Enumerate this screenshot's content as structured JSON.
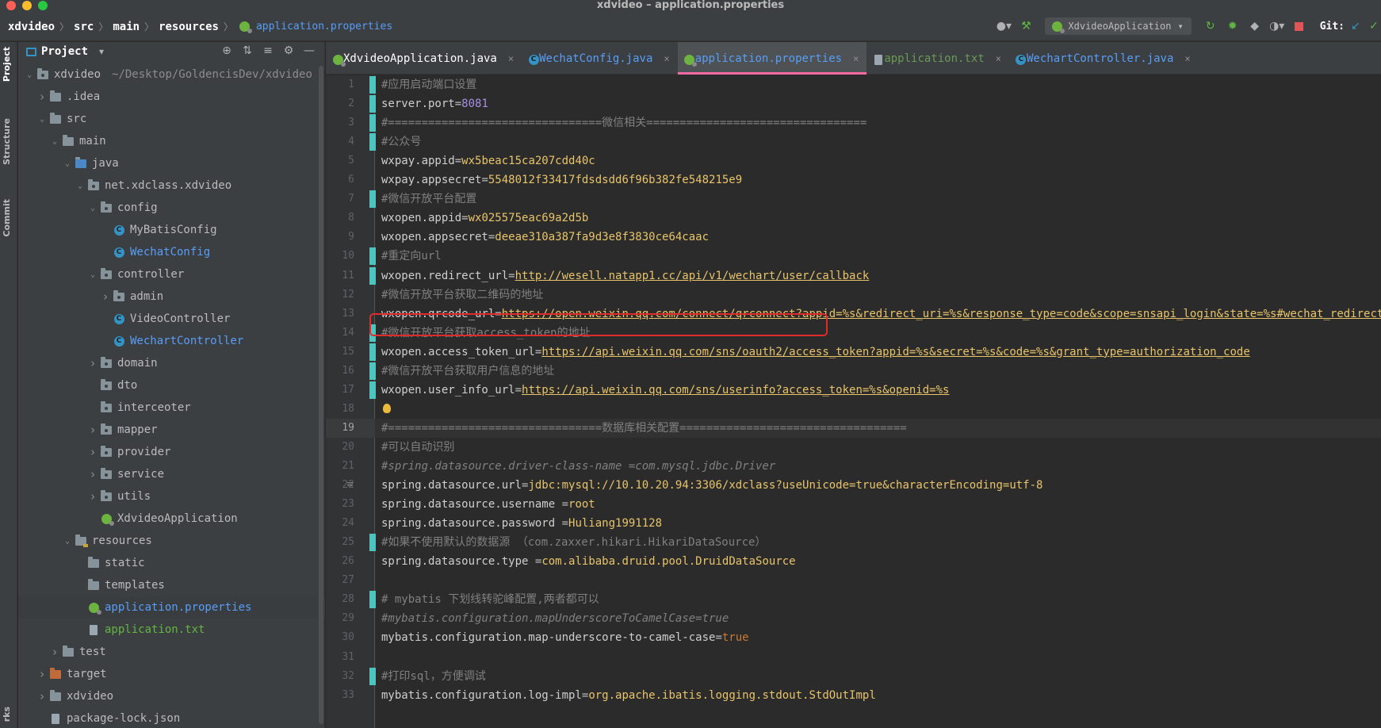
{
  "window": {
    "title": "xdvideo – application.properties",
    "traffic_colors": [
      "#ff5f57",
      "#febc2e",
      "#28c840"
    ]
  },
  "breadcrumb": [
    "xdvideo",
    "src",
    "main",
    "resources"
  ],
  "breadcrumb_file": "application.properties",
  "toolbar": {
    "run_config": "XdvideoApplication",
    "git_label": "Git:"
  },
  "toolstrip": {
    "project": "Project",
    "structure": "Structure",
    "commit": "Commit",
    "bookmarks": "rks"
  },
  "project_panel": {
    "title": "Project",
    "tree": [
      {
        "label": "xdvideo",
        "extra": "~/Desktop/GoldencisDev/xdvideo",
        "depth": 0,
        "chev": "open",
        "icon": "module",
        "color": "strong"
      },
      {
        "label": ".idea",
        "depth": 1,
        "chev": "closed",
        "icon": "folder",
        "color": "default"
      },
      {
        "label": "src",
        "depth": 1,
        "chev": "open",
        "icon": "folder",
        "color": "default"
      },
      {
        "label": "main",
        "depth": 2,
        "chev": "open",
        "icon": "folder",
        "color": "default"
      },
      {
        "label": "java",
        "depth": 3,
        "chev": "open",
        "icon": "folder-src",
        "color": "default"
      },
      {
        "label": "net.xdclass.xdvideo",
        "depth": 4,
        "chev": "open",
        "icon": "package",
        "color": "default"
      },
      {
        "label": "config",
        "depth": 5,
        "chev": "open",
        "icon": "package",
        "color": "default"
      },
      {
        "label": "MyBatisConfig",
        "depth": 6,
        "chev": "",
        "icon": "class",
        "color": "default"
      },
      {
        "label": "WechatConfig",
        "depth": 6,
        "chev": "",
        "icon": "class",
        "color": "blue"
      },
      {
        "label": "controller",
        "depth": 5,
        "chev": "open",
        "icon": "package",
        "color": "default"
      },
      {
        "label": "admin",
        "depth": 6,
        "chev": "closed",
        "icon": "package",
        "color": "default"
      },
      {
        "label": "VideoController",
        "depth": 6,
        "chev": "",
        "icon": "class",
        "color": "default"
      },
      {
        "label": "WechartController",
        "depth": 6,
        "chev": "",
        "icon": "class",
        "color": "blue"
      },
      {
        "label": "domain",
        "depth": 5,
        "chev": "closed",
        "icon": "package",
        "color": "default"
      },
      {
        "label": "dto",
        "depth": 5,
        "chev": "",
        "icon": "package",
        "color": "default"
      },
      {
        "label": "interceoter",
        "depth": 5,
        "chev": "",
        "icon": "package",
        "color": "default"
      },
      {
        "label": "mapper",
        "depth": 5,
        "chev": "closed",
        "icon": "package",
        "color": "default"
      },
      {
        "label": "provider",
        "depth": 5,
        "chev": "closed",
        "icon": "package",
        "color": "default"
      },
      {
        "label": "service",
        "depth": 5,
        "chev": "closed",
        "icon": "package",
        "color": "default"
      },
      {
        "label": "utils",
        "depth": 5,
        "chev": "closed",
        "icon": "package",
        "color": "default"
      },
      {
        "label": "XdvideoApplication",
        "depth": 5,
        "chev": "",
        "icon": "spring-class",
        "color": "default"
      },
      {
        "label": "resources",
        "depth": 3,
        "chev": "open",
        "icon": "folder-res",
        "color": "default"
      },
      {
        "label": "static",
        "depth": 4,
        "chev": "",
        "icon": "folder",
        "color": "default"
      },
      {
        "label": "templates",
        "depth": 4,
        "chev": "",
        "icon": "folder",
        "color": "default"
      },
      {
        "label": "application.properties",
        "depth": 4,
        "chev": "",
        "icon": "spring-file",
        "color": "blue",
        "selected": true
      },
      {
        "label": "application.txt",
        "depth": 4,
        "chev": "",
        "icon": "file",
        "color": "green"
      },
      {
        "label": "test",
        "depth": 2,
        "chev": "closed",
        "icon": "folder",
        "color": "default"
      },
      {
        "label": "target",
        "depth": 1,
        "chev": "closed",
        "icon": "folder-orange",
        "color": "default"
      },
      {
        "label": "xdvideo",
        "depth": 1,
        "chev": "closed",
        "icon": "folder",
        "color": "default"
      },
      {
        "label": "package-lock.json",
        "depth": 1,
        "chev": "",
        "icon": "file-json",
        "color": "default"
      }
    ]
  },
  "tabs": [
    {
      "label": "XdvideoApplication.java",
      "icon": "spring-class",
      "color": "#ffffff",
      "active": false
    },
    {
      "label": "WechatConfig.java",
      "icon": "class",
      "color": "#589df6",
      "active": false
    },
    {
      "label": "application.properties",
      "icon": "spring-file",
      "color": "#589df6",
      "active": true
    },
    {
      "label": "application.txt",
      "icon": "file",
      "color": "#6a9955",
      "active": false
    },
    {
      "label": "WechartController.java",
      "icon": "class",
      "color": "#589df6",
      "active": false
    }
  ],
  "editor": {
    "current_line": 19,
    "lines": [
      {
        "n": "1",
        "parts": [
          [
            "cmt",
            "#应用启动端口设置"
          ]
        ],
        "changed": true
      },
      {
        "n": "2",
        "parts": [
          [
            "key",
            "server.port"
          ],
          [
            "eq",
            "="
          ],
          [
            "num",
            "8081"
          ]
        ],
        "changed": true
      },
      {
        "n": "3",
        "parts": [
          [
            "cmt",
            "#================================微信相关================================="
          ]
        ],
        "changed": true
      },
      {
        "n": "4",
        "parts": [
          [
            "cmt",
            "#公众号"
          ]
        ],
        "changed": true
      },
      {
        "n": "5",
        "parts": [
          [
            "key",
            "wxpay.appid"
          ],
          [
            "eq",
            "="
          ],
          [
            "val",
            "wx5beac15ca207cdd40c"
          ]
        ],
        "changed": false
      },
      {
        "n": "6",
        "parts": [
          [
            "key",
            "wxpay.appsecret"
          ],
          [
            "eq",
            "="
          ],
          [
            "val",
            "5548012f33417fdsdsdd6f96b382fe548215e9"
          ]
        ],
        "changed": false
      },
      {
        "n": "7",
        "parts": [
          [
            "cmt",
            "#微信开放平台配置"
          ]
        ],
        "changed": true
      },
      {
        "n": "8",
        "parts": [
          [
            "key",
            "wxopen.appid"
          ],
          [
            "eq",
            "="
          ],
          [
            "val",
            "wx025575eac69a2d5b"
          ]
        ],
        "changed": false
      },
      {
        "n": "9",
        "parts": [
          [
            "key",
            "wxopen.appsecret"
          ],
          [
            "eq",
            "="
          ],
          [
            "val",
            "deeae310a387fa9d3e8f3830ce64caac"
          ]
        ],
        "changed": false
      },
      {
        "n": "10",
        "parts": [
          [
            "cmt",
            "#重定向url"
          ]
        ],
        "changed": true
      },
      {
        "n": "11",
        "parts": [
          [
            "key",
            "wxopen.redirect_url"
          ],
          [
            "eq",
            "="
          ],
          [
            "url",
            "http://wesell.natapp1.cc/api/v1/wechart/user/callback"
          ]
        ],
        "changed": true
      },
      {
        "n": "12",
        "parts": [
          [
            "cmt",
            "#微信开放平台获取二维码的地址"
          ]
        ],
        "changed": false
      },
      {
        "n": "13",
        "parts": [
          [
            "key",
            "wxopen.qrcode_url"
          ],
          [
            "eq",
            "="
          ],
          [
            "url",
            "https://open.weixin.qq.com/connect/qrconnect?appid=%s&redirect_uri=%s&response_type=code&scope=snsapi_login&state=%s#wechat_redirect"
          ]
        ],
        "changed": false
      },
      {
        "n": "14",
        "parts": [
          [
            "cmt",
            "#微信开放平台获取access_token的地址"
          ]
        ],
        "changed": true
      },
      {
        "n": "15",
        "parts": [
          [
            "key",
            "wxopen.access_token_url"
          ],
          [
            "eq",
            "="
          ],
          [
            "url",
            "https://api.weixin.qq.com/sns/oauth2/access_token?appid=%s&secret=%s&code=%s&grant_type=authorization_code"
          ]
        ],
        "changed": true
      },
      {
        "n": "16",
        "parts": [
          [
            "cmt",
            "#微信开放平台获取用户信息的地址"
          ]
        ],
        "changed": true
      },
      {
        "n": "17",
        "parts": [
          [
            "key",
            "wxopen.user_info_url"
          ],
          [
            "eq",
            "="
          ],
          [
            "url",
            "https://api.weixin.qq.com/sns/userinfo?access_token=%s&openid=%s"
          ]
        ],
        "changed": true
      },
      {
        "n": "18",
        "parts": [],
        "changed": false
      },
      {
        "n": "19",
        "parts": [
          [
            "cmt",
            "#================================数据库相关配置=================================="
          ]
        ],
        "changed": false
      },
      {
        "n": "20",
        "parts": [
          [
            "cmt",
            "#可以自动识别"
          ]
        ],
        "changed": false
      },
      {
        "n": "21",
        "parts": [
          [
            "cmti",
            "#spring.datasource.driver-class-name =com.mysql.jdbc.Driver"
          ]
        ],
        "changed": false
      },
      {
        "n": "22",
        "parts": [
          [
            "key",
            "spring.datasource.url"
          ],
          [
            "eq",
            "="
          ],
          [
            "val",
            "jdbc:mysql://10.10.20.94:3306/xdclass?useUnicode=true&characterEncoding=utf-8"
          ]
        ],
        "changed": false
      },
      {
        "n": "23",
        "parts": [
          [
            "key",
            "spring.datasource.username "
          ],
          [
            "eq",
            "="
          ],
          [
            "val",
            "root"
          ]
        ],
        "changed": false
      },
      {
        "n": "24",
        "parts": [
          [
            "key",
            "spring.datasource.password "
          ],
          [
            "eq",
            "="
          ],
          [
            "val",
            "Huliang1991128"
          ]
        ],
        "changed": false
      },
      {
        "n": "25",
        "parts": [
          [
            "cmt",
            "#如果不使用默认的数据源 （com.zaxxer.hikari.HikariDataSource）"
          ]
        ],
        "changed": true
      },
      {
        "n": "26",
        "parts": [
          [
            "key",
            "spring.datasource.type "
          ],
          [
            "eq",
            "="
          ],
          [
            "val",
            "com.alibaba.druid.pool.DruidDataSource"
          ]
        ],
        "changed": false
      },
      {
        "n": "27",
        "parts": [],
        "changed": false
      },
      {
        "n": "28",
        "parts": [
          [
            "cmt",
            "# mybatis 下划线转驼峰配置,两者都可以"
          ]
        ],
        "changed": true
      },
      {
        "n": "29",
        "parts": [
          [
            "cmti",
            "#mybatis.configuration.mapUnderscoreToCamelCase=true"
          ]
        ],
        "changed": false
      },
      {
        "n": "30",
        "parts": [
          [
            "key",
            "mybatis.configuration.map-underscore-to-camel-case"
          ],
          [
            "eq",
            "="
          ],
          [
            "bool",
            "true"
          ]
        ],
        "changed": false
      },
      {
        "n": "31",
        "parts": [],
        "changed": false
      },
      {
        "n": "32",
        "parts": [
          [
            "cmt",
            "#打印sql，方便调试"
          ]
        ],
        "changed": true
      },
      {
        "n": "33",
        "parts": [
          [
            "key",
            "mybatis.configuration.log-impl"
          ],
          [
            "eq",
            "="
          ],
          [
            "val",
            "org.apache.ibatis.logging.stdout.StdOutImpl"
          ]
        ],
        "changed": false
      }
    ]
  }
}
